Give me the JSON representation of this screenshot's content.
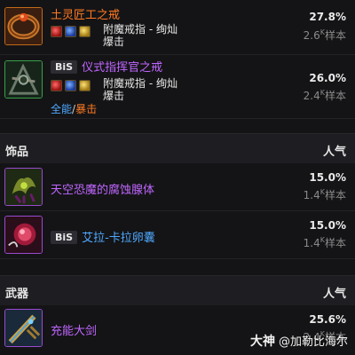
{
  "rings": [
    {
      "bis": "",
      "name": "土灵匠工之戒",
      "stats": [
        "附魔戒指 - 绚灿",
        "爆击"
      ],
      "percent": "27.8%",
      "samples_num": "2.6",
      "samples_unit": "K",
      "samples_label": "样本"
    },
    {
      "bis": "BiS",
      "name": "仪式指挥官之戒",
      "stats": [
        "附魔戒指 - 绚灿",
        "爆击"
      ],
      "percent": "26.0%",
      "samples_num": "2.4",
      "samples_unit": "K",
      "samples_label": "样本",
      "links": {
        "all": "全能",
        "sep": "/",
        "crit": "暴击"
      }
    }
  ],
  "trinkets_section": {
    "title": "饰品",
    "popularity": "人气",
    "items": [
      {
        "bis": "",
        "name": "天空恐魔的腐蚀腺体",
        "percent": "15.0%",
        "samples_num": "1.4",
        "samples_unit": "K",
        "samples_label": "样本"
      },
      {
        "bis": "BiS",
        "name": "艾拉-卡拉卵囊",
        "percent": "15.0%",
        "samples_num": "1.4",
        "samples_unit": "K",
        "samples_label": "样本"
      }
    ]
  },
  "weapons_section": {
    "title": "武器",
    "popularity": "人气",
    "items": [
      {
        "bis": "",
        "name": "充能大剑",
        "percent": "25.6%",
        "samples_num": "2.4",
        "samples_unit": "K",
        "samples_label": "样本"
      }
    ]
  },
  "watermark": {
    "logo": "大神",
    "text": "@加勒比海尔"
  }
}
